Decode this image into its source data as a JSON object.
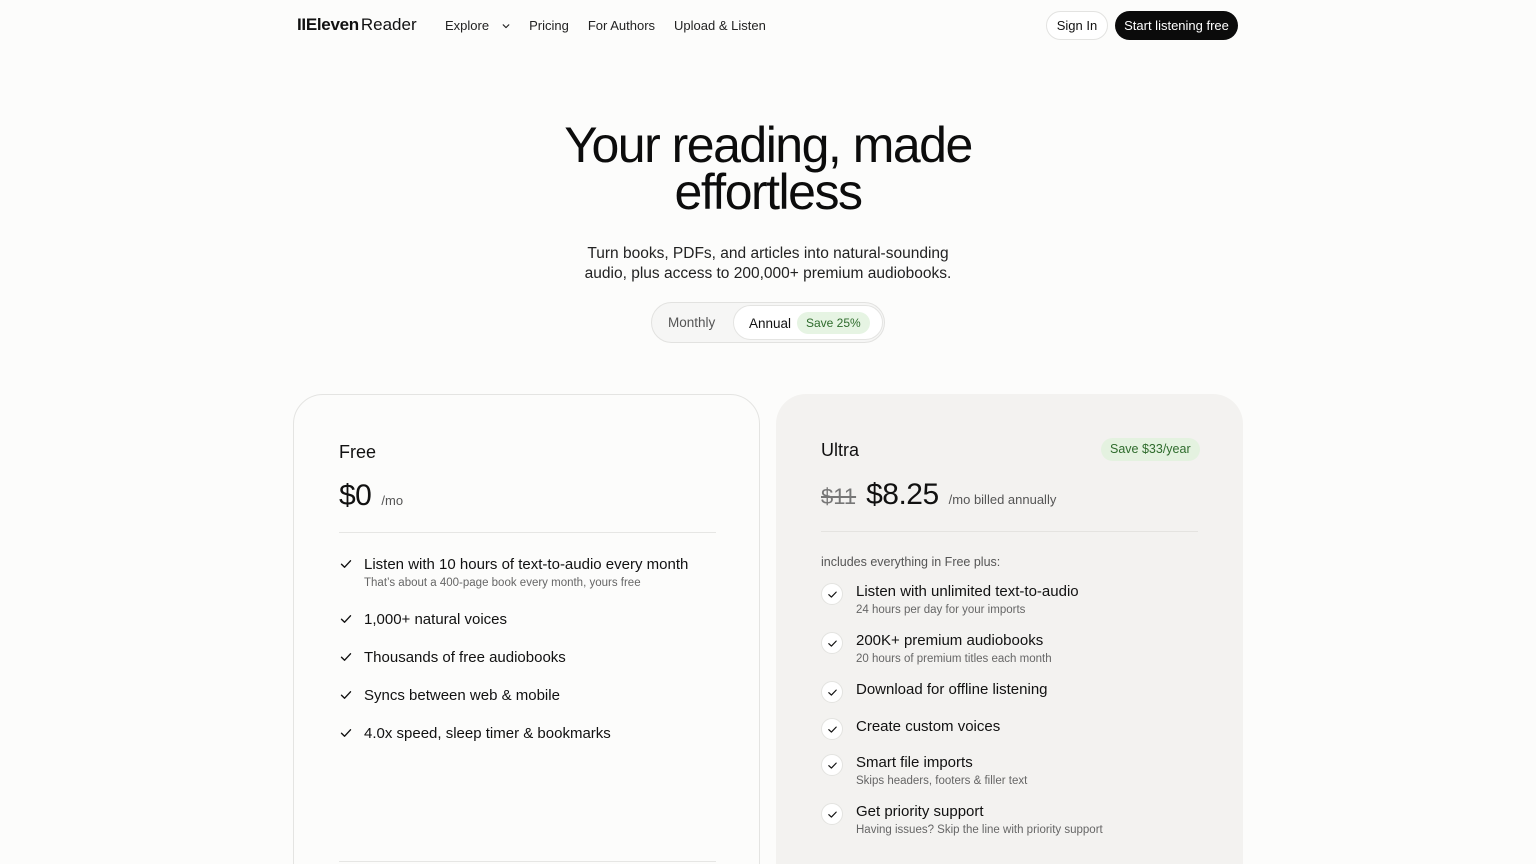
{
  "nav": {
    "logo_bold": "IIEleven",
    "logo_light": "Reader",
    "links": [
      "Explore",
      "Pricing",
      "For Authors",
      "Upload & Listen"
    ],
    "sign_in": "Sign In",
    "cta": "Start listening free"
  },
  "hero": {
    "title": "Your reading, made effortless",
    "subtitle": "Turn books, PDFs, and articles into natural-sounding audio, plus access to 200,000+ premium audiobooks."
  },
  "billing_toggle": {
    "monthly": "Monthly",
    "annual": "Annual",
    "annual_badge": "Save 25%",
    "selected": "Annual"
  },
  "plans": {
    "free": {
      "name": "Free",
      "price": "$0",
      "period": "/mo",
      "features": [
        {
          "title": "Listen with 10 hours of text-to-audio every month",
          "sub": "That’s about a 400-page book every month, yours free"
        },
        {
          "title": "1,000+ natural voices",
          "sub": ""
        },
        {
          "title": "Thousands of free audiobooks",
          "sub": ""
        },
        {
          "title": "Syncs between web & mobile",
          "sub": ""
        },
        {
          "title": "4.0x speed, sleep timer & bookmarks",
          "sub": ""
        }
      ]
    },
    "ultra": {
      "name": "Ultra",
      "badge": "Save $33/year",
      "old_price": "$11",
      "price": "$8.25",
      "period": "/mo billed annually",
      "includes": "includes everything in Free plus:",
      "features": [
        {
          "title": "Listen with unlimited text-to-audio",
          "sub": "24 hours per day for your imports"
        },
        {
          "title": "200K+ premium audiobooks",
          "sub": "20 hours of premium titles each month"
        },
        {
          "title": "Download for offline listening",
          "sub": ""
        },
        {
          "title": "Create custom voices",
          "sub": ""
        },
        {
          "title": "Smart file imports",
          "sub": "Skips headers, footers & filler text"
        },
        {
          "title": "Get priority support",
          "sub": "Having issues? Skip the line with priority support"
        }
      ]
    }
  },
  "colors": {
    "accent_dark": "#0b0b0b",
    "badge_green_bg": "#e4f2e0",
    "badge_green_text": "#2e6b2c",
    "ultra_card_bg": "#f3f2f0"
  }
}
